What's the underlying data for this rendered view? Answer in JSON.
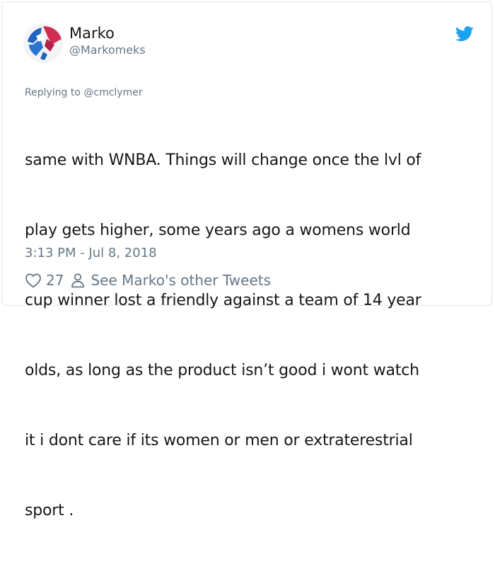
{
  "tweet": {
    "author_name": "Marko",
    "author_handle": "@Markomeks",
    "reply_to": "Replying to @cmclymer",
    "text_lines": [
      "same with WNBA. Things will change once the lvl of",
      "play gets higher, some years ago a womens world",
      "cup winner lost a friendly against a team of 14 year",
      "olds,  as long as the product isn’t good i wont watch",
      "it i dont care if its women or men or extraterestrial",
      "sport ."
    ],
    "timestamp": "3:13 PM - Jul 8, 2018",
    "like_count": "27",
    "other_tweets_label": "See Marko's other Tweets"
  },
  "icons": {
    "logo": "twitter-bird-icon",
    "like": "heart-icon",
    "profile": "person-icon"
  },
  "colors": {
    "brand": "#1da1f2",
    "text": "#14171a",
    "muted": "#657786",
    "border": "#e1e8ed"
  }
}
